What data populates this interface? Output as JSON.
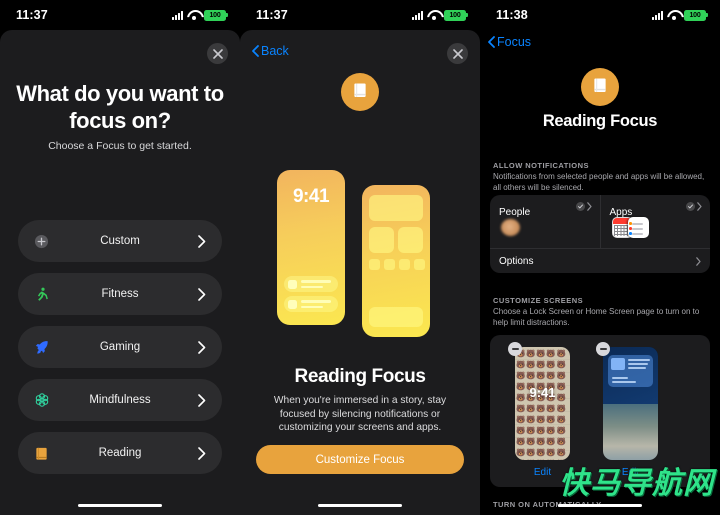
{
  "panels": [
    {
      "status": {
        "time": "11:37",
        "battery": "100",
        "signal_icon": "cellular-signal-icon",
        "wifi_icon": "wifi-icon",
        "battery_icon": "battery-full-icon"
      },
      "close_icon": "close-icon",
      "title": "What do you want to focus on?",
      "subtitle": "Choose a Focus to get started.",
      "focus_options": [
        {
          "label": "Custom",
          "icon": "plus-circle-icon",
          "color": "#8e8e93"
        },
        {
          "label": "Fitness",
          "icon": "running-person-icon",
          "color": "#34c759"
        },
        {
          "label": "Gaming",
          "icon": "rocket-icon",
          "color": "#2f6bff"
        },
        {
          "label": "Mindfulness",
          "icon": "flower-icon",
          "color": "#30d5a0"
        },
        {
          "label": "Reading",
          "icon": "book-icon",
          "color": "#e8a33d"
        }
      ],
      "chevron_icon": "chevron-right-icon",
      "home_indicator": "home-indicator"
    },
    {
      "status": {
        "time": "11:37",
        "battery": "100"
      },
      "back_label": "Back",
      "back_icon": "chevron-left-icon",
      "close_icon": "close-icon",
      "badge_icon": "book-icon",
      "preview": {
        "lock_time": "9:41",
        "lock_screen_name": "lock-screen-preview",
        "home_screen_name": "home-screen-preview"
      },
      "title": "Reading Focus",
      "description": "When you're immersed in a story, stay focused by silencing notifications or customizing your screens and apps.",
      "cta_label": "Customize Focus",
      "cta_color": "#e8a33d"
    },
    {
      "status": {
        "time": "11:38",
        "battery": "100"
      },
      "nav_back_label": "Focus",
      "nav_back_icon": "chevron-left-icon",
      "icon": "book-icon",
      "title": "Reading Focus",
      "allow": {
        "header": "ALLOW NOTIFICATIONS",
        "description": "Notifications from selected people and apps will be allowed, all others will be silenced.",
        "people_label": "People",
        "apps_label": "Apps",
        "check_icon": "check-circle-icon",
        "chevron_icon": "chevron-right-icon",
        "options_label": "Options",
        "avatar_name": "person-avatar",
        "app_icons": [
          "calendar-app-icon",
          "reminders-app-icon"
        ]
      },
      "customize": {
        "header": "CUSTOMIZE SCREENS",
        "description": "Choose a Lock Screen or Home Screen page to turn on to help limit distractions.",
        "lock_edit_label": "Edit",
        "home_edit_label": "Edit",
        "lock_time": "9:41",
        "remove_icon": "minus-circle-icon",
        "lock_wallpaper_emoji": "🐻🐻🐻🐻🐻🐻🐻🐻🐻🐻🐻🐻🐻🐻🐻🐻🐻🐻🐻🐻🐻🐻🐻🐻🐻🐻🐻🐻🐻🐻🐻🐻🐻🐻🐻🐻🐻🐻🐻🐻🐻🐻🐻🐻🐻🐻🐻🐻🐻🐻🐻🐻🐻🐻🐻🐻🐻🐻🐻🐻🐻🐻🐻🐻🐻🐻🐻🐻"
      },
      "bottom_header": "TURN ON AUTOMATICALLY"
    }
  ],
  "watermark": {
    "text": "快马导航网",
    "color": "#2fe38a"
  }
}
